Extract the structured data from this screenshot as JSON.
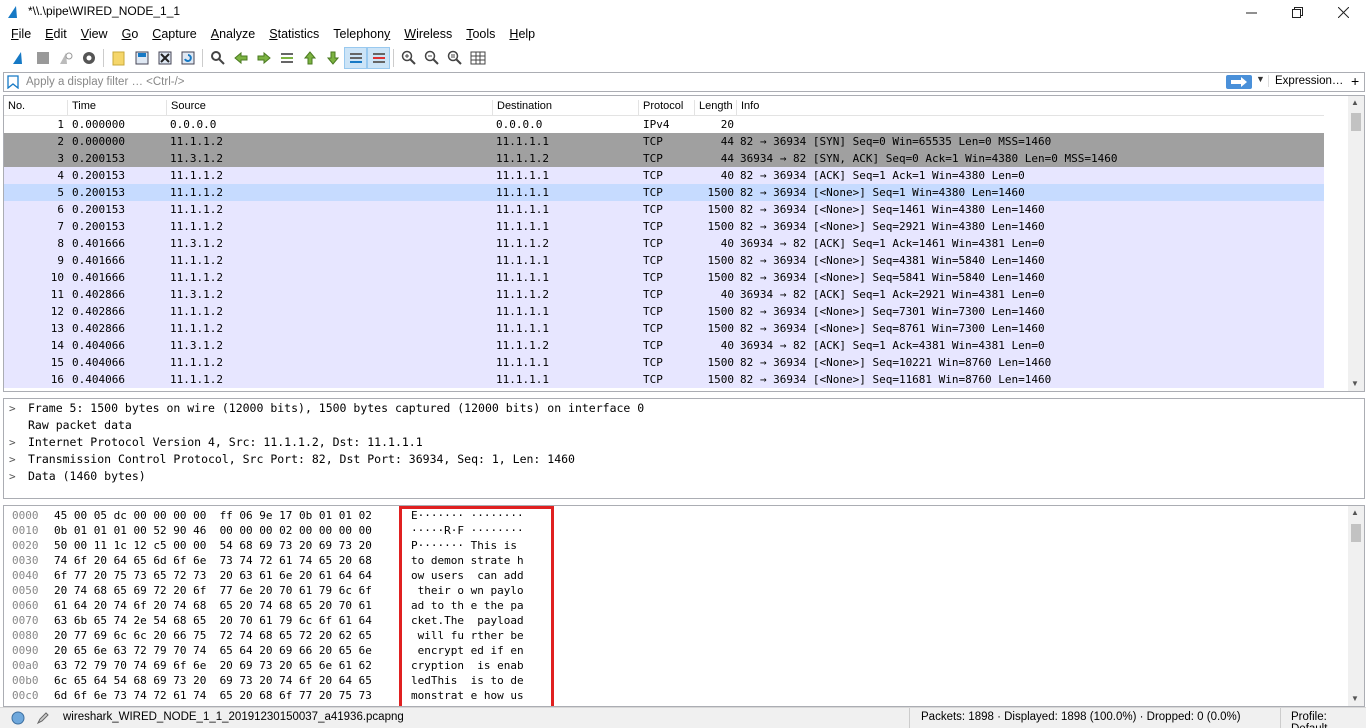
{
  "window": {
    "title": "*\\\\.\\pipe\\WIRED_NODE_1_1"
  },
  "menu": [
    {
      "pre": "",
      "u": "F",
      "post": "ile"
    },
    {
      "pre": "",
      "u": "E",
      "post": "dit"
    },
    {
      "pre": "",
      "u": "V",
      "post": "iew"
    },
    {
      "pre": "",
      "u": "G",
      "post": "o"
    },
    {
      "pre": "",
      "u": "C",
      "post": "apture"
    },
    {
      "pre": "",
      "u": "A",
      "post": "nalyze"
    },
    {
      "pre": "",
      "u": "S",
      "post": "tatistics"
    },
    {
      "pre": "Telephon",
      "u": "y",
      "post": ""
    },
    {
      "pre": "",
      "u": "W",
      "post": "ireless"
    },
    {
      "pre": "",
      "u": "T",
      "post": "ools"
    },
    {
      "pre": "",
      "u": "H",
      "post": "elp"
    }
  ],
  "filter": {
    "placeholder": "Apply a display filter … <Ctrl-/>",
    "expression_label": "Expression…",
    "plus_label": "+"
  },
  "columns": [
    "No.",
    "Time",
    "Source",
    "Destination",
    "Protocol",
    "Length",
    "Info"
  ],
  "packets": [
    {
      "no": "1",
      "time": "0.000000",
      "src": "0.0.0.0",
      "dst": "0.0.0.0",
      "proto": "IPv4",
      "len": "20",
      "info": "",
      "style": "plain"
    },
    {
      "no": "2",
      "time": "0.000000",
      "src": "11.1.1.2",
      "dst": "11.1.1.1",
      "proto": "TCP",
      "len": "44",
      "info": "82 → 36934 [SYN] Seq=0 Win=65535 Len=0 MSS=1460",
      "style": "gray"
    },
    {
      "no": "3",
      "time": "0.200153",
      "src": "11.3.1.2",
      "dst": "11.1.1.2",
      "proto": "TCP",
      "len": "44",
      "info": "36934 → 82 [SYN, ACK] Seq=0 Ack=1 Win=4380 Len=0 MSS=1460",
      "style": "gray"
    },
    {
      "no": "4",
      "time": "0.200153",
      "src": "11.1.1.2",
      "dst": "11.1.1.1",
      "proto": "TCP",
      "len": "40",
      "info": "82 → 36934 [ACK] Seq=1 Ack=1 Win=4380 Len=0",
      "style": "tcp"
    },
    {
      "no": "5",
      "time": "0.200153",
      "src": "11.1.1.2",
      "dst": "11.1.1.1",
      "proto": "TCP",
      "len": "1500",
      "info": "82 → 36934 [<None>] Seq=1 Win=4380 Len=1460",
      "style": "selected"
    },
    {
      "no": "6",
      "time": "0.200153",
      "src": "11.1.1.2",
      "dst": "11.1.1.1",
      "proto": "TCP",
      "len": "1500",
      "info": "82 → 36934 [<None>] Seq=1461 Win=4380 Len=1460",
      "style": "tcp"
    },
    {
      "no": "7",
      "time": "0.200153",
      "src": "11.1.1.2",
      "dst": "11.1.1.1",
      "proto": "TCP",
      "len": "1500",
      "info": "82 → 36934 [<None>] Seq=2921 Win=4380 Len=1460",
      "style": "tcp"
    },
    {
      "no": "8",
      "time": "0.401666",
      "src": "11.3.1.2",
      "dst": "11.1.1.2",
      "proto": "TCP",
      "len": "40",
      "info": "36934 → 82 [ACK] Seq=1 Ack=1461 Win=4381 Len=0",
      "style": "tcp"
    },
    {
      "no": "9",
      "time": "0.401666",
      "src": "11.1.1.2",
      "dst": "11.1.1.1",
      "proto": "TCP",
      "len": "1500",
      "info": "82 → 36934 [<None>] Seq=4381 Win=5840 Len=1460",
      "style": "tcp"
    },
    {
      "no": "10",
      "time": "0.401666",
      "src": "11.1.1.2",
      "dst": "11.1.1.1",
      "proto": "TCP",
      "len": "1500",
      "info": "82 → 36934 [<None>] Seq=5841 Win=5840 Len=1460",
      "style": "tcp"
    },
    {
      "no": "11",
      "time": "0.402866",
      "src": "11.3.1.2",
      "dst": "11.1.1.2",
      "proto": "TCP",
      "len": "40",
      "info": "36934 → 82 [ACK] Seq=1 Ack=2921 Win=4381 Len=0",
      "style": "tcp"
    },
    {
      "no": "12",
      "time": "0.402866",
      "src": "11.1.1.2",
      "dst": "11.1.1.1",
      "proto": "TCP",
      "len": "1500",
      "info": "82 → 36934 [<None>] Seq=7301 Win=7300 Len=1460",
      "style": "tcp"
    },
    {
      "no": "13",
      "time": "0.402866",
      "src": "11.1.1.2",
      "dst": "11.1.1.1",
      "proto": "TCP",
      "len": "1500",
      "info": "82 → 36934 [<None>] Seq=8761 Win=7300 Len=1460",
      "style": "tcp"
    },
    {
      "no": "14",
      "time": "0.404066",
      "src": "11.3.1.2",
      "dst": "11.1.1.2",
      "proto": "TCP",
      "len": "40",
      "info": "36934 → 82 [ACK] Seq=1 Ack=4381 Win=4381 Len=0",
      "style": "tcp"
    },
    {
      "no": "15",
      "time": "0.404066",
      "src": "11.1.1.2",
      "dst": "11.1.1.1",
      "proto": "TCP",
      "len": "1500",
      "info": "82 → 36934 [<None>] Seq=10221 Win=8760 Len=1460",
      "style": "tcp"
    },
    {
      "no": "16",
      "time": "0.404066",
      "src": "11.1.1.2",
      "dst": "11.1.1.1",
      "proto": "TCP",
      "len": "1500",
      "info": "82 → 36934 [<None>] Seq=11681 Win=8760 Len=1460",
      "style": "tcp"
    }
  ],
  "row_colors": {
    "plain": "#ffffff",
    "gray": "#a0a0a0",
    "tcp": "#e7e6ff",
    "selected": "#c6dbff"
  },
  "details": [
    {
      "chev": ">",
      "text": "Frame 5: 1500 bytes on wire (12000 bits), 1500 bytes captured (12000 bits) on interface 0"
    },
    {
      "chev": "",
      "text": "Raw packet data"
    },
    {
      "chev": ">",
      "text": "Internet Protocol Version 4, Src: 11.1.1.2, Dst: 11.1.1.1"
    },
    {
      "chev": ">",
      "text": "Transmission Control Protocol, Src Port: 82, Dst Port: 36934, Seq: 1, Len: 1460"
    },
    {
      "chev": ">",
      "text": "Data (1460 bytes)"
    }
  ],
  "bytes": [
    {
      "off": "0000",
      "hex": "45 00 05 dc 00 00 00 00  ff 06 9e 17 0b 01 01 02",
      "ascii": "E······· ········"
    },
    {
      "off": "0010",
      "hex": "0b 01 01 01 00 52 90 46  00 00 00 02 00 00 00 00",
      "ascii": "·····R·F ········"
    },
    {
      "off": "0020",
      "hex": "50 00 11 1c 12 c5 00 00  54 68 69 73 20 69 73 20",
      "ascii": "P······· This is "
    },
    {
      "off": "0030",
      "hex": "74 6f 20 64 65 6d 6f 6e  73 74 72 61 74 65 20 68",
      "ascii": "to demon strate h"
    },
    {
      "off": "0040",
      "hex": "6f 77 20 75 73 65 72 73  20 63 61 6e 20 61 64 64",
      "ascii": "ow users  can add"
    },
    {
      "off": "0050",
      "hex": "20 74 68 65 69 72 20 6f  77 6e 20 70 61 79 6c 6f",
      "ascii": " their o wn paylo"
    },
    {
      "off": "0060",
      "hex": "61 64 20 74 6f 20 74 68  65 20 74 68 65 20 70 61",
      "ascii": "ad to th e the pa"
    },
    {
      "off": "0070",
      "hex": "63 6b 65 74 2e 54 68 65  20 70 61 79 6c 6f 61 64",
      "ascii": "cket.The  payload"
    },
    {
      "off": "0080",
      "hex": "20 77 69 6c 6c 20 66 75  72 74 68 65 72 20 62 65",
      "ascii": " will fu rther be"
    },
    {
      "off": "0090",
      "hex": "20 65 6e 63 72 79 70 74  65 64 20 69 66 20 65 6e",
      "ascii": " encrypt ed if en"
    },
    {
      "off": "00a0",
      "hex": "63 72 79 70 74 69 6f 6e  20 69 73 20 65 6e 61 62",
      "ascii": "cryption  is enab"
    },
    {
      "off": "00b0",
      "hex": "6c 65 64 54 68 69 73 20  69 73 20 74 6f 20 64 65",
      "ascii": "ledThis  is to de"
    },
    {
      "off": "00c0",
      "hex": "6d 6f 6e 73 74 72 61 74  65 20 68 6f 77 20 75 73",
      "ascii": "monstrat e how us"
    }
  ],
  "status": {
    "file": "wireshark_WIRED_NODE_1_1_20191230150037_a41936.pcapng",
    "packets": "Packets: 1898 · Displayed: 1898 (100.0%) · Dropped: 0 (0.0%)",
    "profile": "Profile: Default"
  },
  "icons": [
    "wireshark-fin-icon",
    "stop-capture-icon",
    "restart-capture-icon",
    "capture-options-icon",
    "open-file-icon",
    "save-file-icon",
    "close-file-icon",
    "reload-file-icon",
    "find-packet-icon",
    "go-back-icon",
    "go-forward-icon",
    "go-to-packet-icon",
    "first-packet-icon",
    "last-packet-icon",
    "autoscroll-icon",
    "colorize-icon",
    "zoom-in-icon",
    "zoom-out-icon",
    "normal-size-icon",
    "resize-columns-icon"
  ]
}
